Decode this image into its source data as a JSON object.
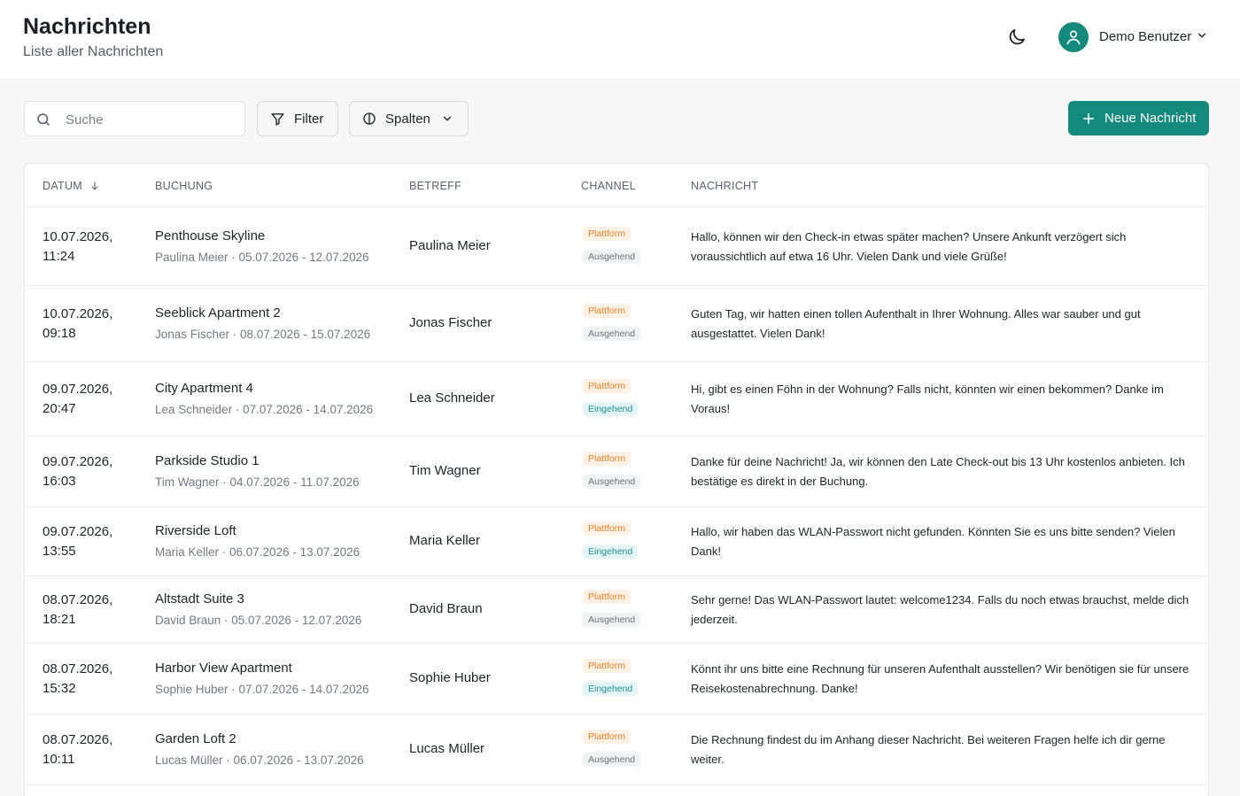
{
  "header": {
    "title": "Nachrichten",
    "subtitle": "Liste aller Nachrichten",
    "user_name": "Demo Benutzer"
  },
  "toolbar": {
    "search_placeholder": "Suche",
    "filter_label": "Filter",
    "columns_label": "Spalten",
    "new_message_label": "Neue Nachricht"
  },
  "colors": {
    "accent": "#16897d",
    "platform_badge": "#e2832a",
    "incoming_badge": "#1f8e96",
    "outgoing_badge": "#6c727a"
  },
  "table": {
    "columns": [
      "DATUM",
      "BUCHUNG",
      "BETREFF",
      "CHANNEL",
      "NACHRICHT"
    ],
    "sort_icon": "arrow-down-icon",
    "rows": [
      {
        "date": "10.07.2026,",
        "time": "11:24",
        "booking": "Penthouse Skyline",
        "booking_sub": "Paulina Meier · 05.07.2026 - 12.07.2026",
        "subject": "Paulina Meier",
        "channel": "Plattform",
        "direction": "Ausgehend",
        "message": "Hallo, können wir den Check-in etwas später machen? Unsere Ankunft verzögert sich voraussichtlich auf etwa 16 Uhr. Vielen Dank und viele Grüße!"
      },
      {
        "date": "10.07.2026,",
        "time": "09:18",
        "booking": "Seeblick Apartment 2",
        "booking_sub": "Jonas Fischer · 08.07.2026 - 15.07.2026",
        "subject": "Jonas Fischer",
        "channel": "Plattform",
        "direction": "Ausgehend",
        "message": "Guten Tag, wir hatten einen tollen Aufenthalt in Ihrer Wohnung. Alles war sauber und gut ausgestattet. Vielen Dank!"
      },
      {
        "date": "09.07.2026,",
        "time": "20:47",
        "booking": "City Apartment 4",
        "booking_sub": "Lea Schneider · 07.07.2026 - 14.07.2026",
        "subject": "Lea Schneider",
        "channel": "Plattform",
        "direction": "Eingehend",
        "message": "Hi, gibt es einen Föhn in der Wohnung? Falls nicht, könnten wir einen bekommen? Danke im Voraus!"
      },
      {
        "date": "09.07.2026,",
        "time": "16:03",
        "booking": "Parkside Studio 1",
        "booking_sub": "Tim Wagner · 04.07.2026 - 11.07.2026",
        "subject": "Tim Wagner",
        "channel": "Plattform",
        "direction": "Ausgehend",
        "message": "Danke für deine Nachricht! Ja, wir können den Late Check-out bis 13 Uhr kostenlos anbieten. Ich bestätige es direkt in der Buchung."
      },
      {
        "date": "09.07.2026,",
        "time": "13:55",
        "booking": "Riverside Loft",
        "booking_sub": "Maria Keller · 06.07.2026 - 13.07.2026",
        "subject": "Maria Keller",
        "channel": "Plattform",
        "direction": "Eingehend",
        "message": "Hallo, wir haben das WLAN-Passwort nicht gefunden. Könnten Sie es uns bitte senden? Vielen Dank!"
      },
      {
        "date": "08.07.2026,",
        "time": "18:21",
        "booking": "Altstadt Suite 3",
        "booking_sub": "David Braun · 05.07.2026 - 12.07.2026",
        "subject": "David Braun",
        "channel": "Plattform",
        "direction": "Ausgehend",
        "message": "Sehr gerne! Das WLAN-Passwort lautet: welcome1234. Falls du noch etwas brauchst, melde dich jederzeit."
      },
      {
        "date": "08.07.2026,",
        "time": "15:32",
        "booking": "Harbor View Apartment",
        "booking_sub": "Sophie Huber · 07.07.2026 - 14.07.2026",
        "subject": "Sophie Huber",
        "channel": "Plattform",
        "direction": "Eingehend",
        "message": "Könnt ihr uns bitte eine Rechnung für unseren Aufenthalt ausstellen? Wir benötigen sie für unsere Reisekostenabrechnung. Danke!"
      },
      {
        "date": "08.07.2026,",
        "time": "10:11",
        "booking": "Garden Loft 2",
        "booking_sub": "Lucas Müller · 06.07.2026 - 13.07.2026",
        "subject": "Lucas Müller",
        "channel": "Plattform",
        "direction": "Ausgehend",
        "message": "Die Rechnung findest du im Anhang dieser Nachricht. Bei weiteren Fragen helfe ich dir gerne weiter."
      }
    ]
  }
}
